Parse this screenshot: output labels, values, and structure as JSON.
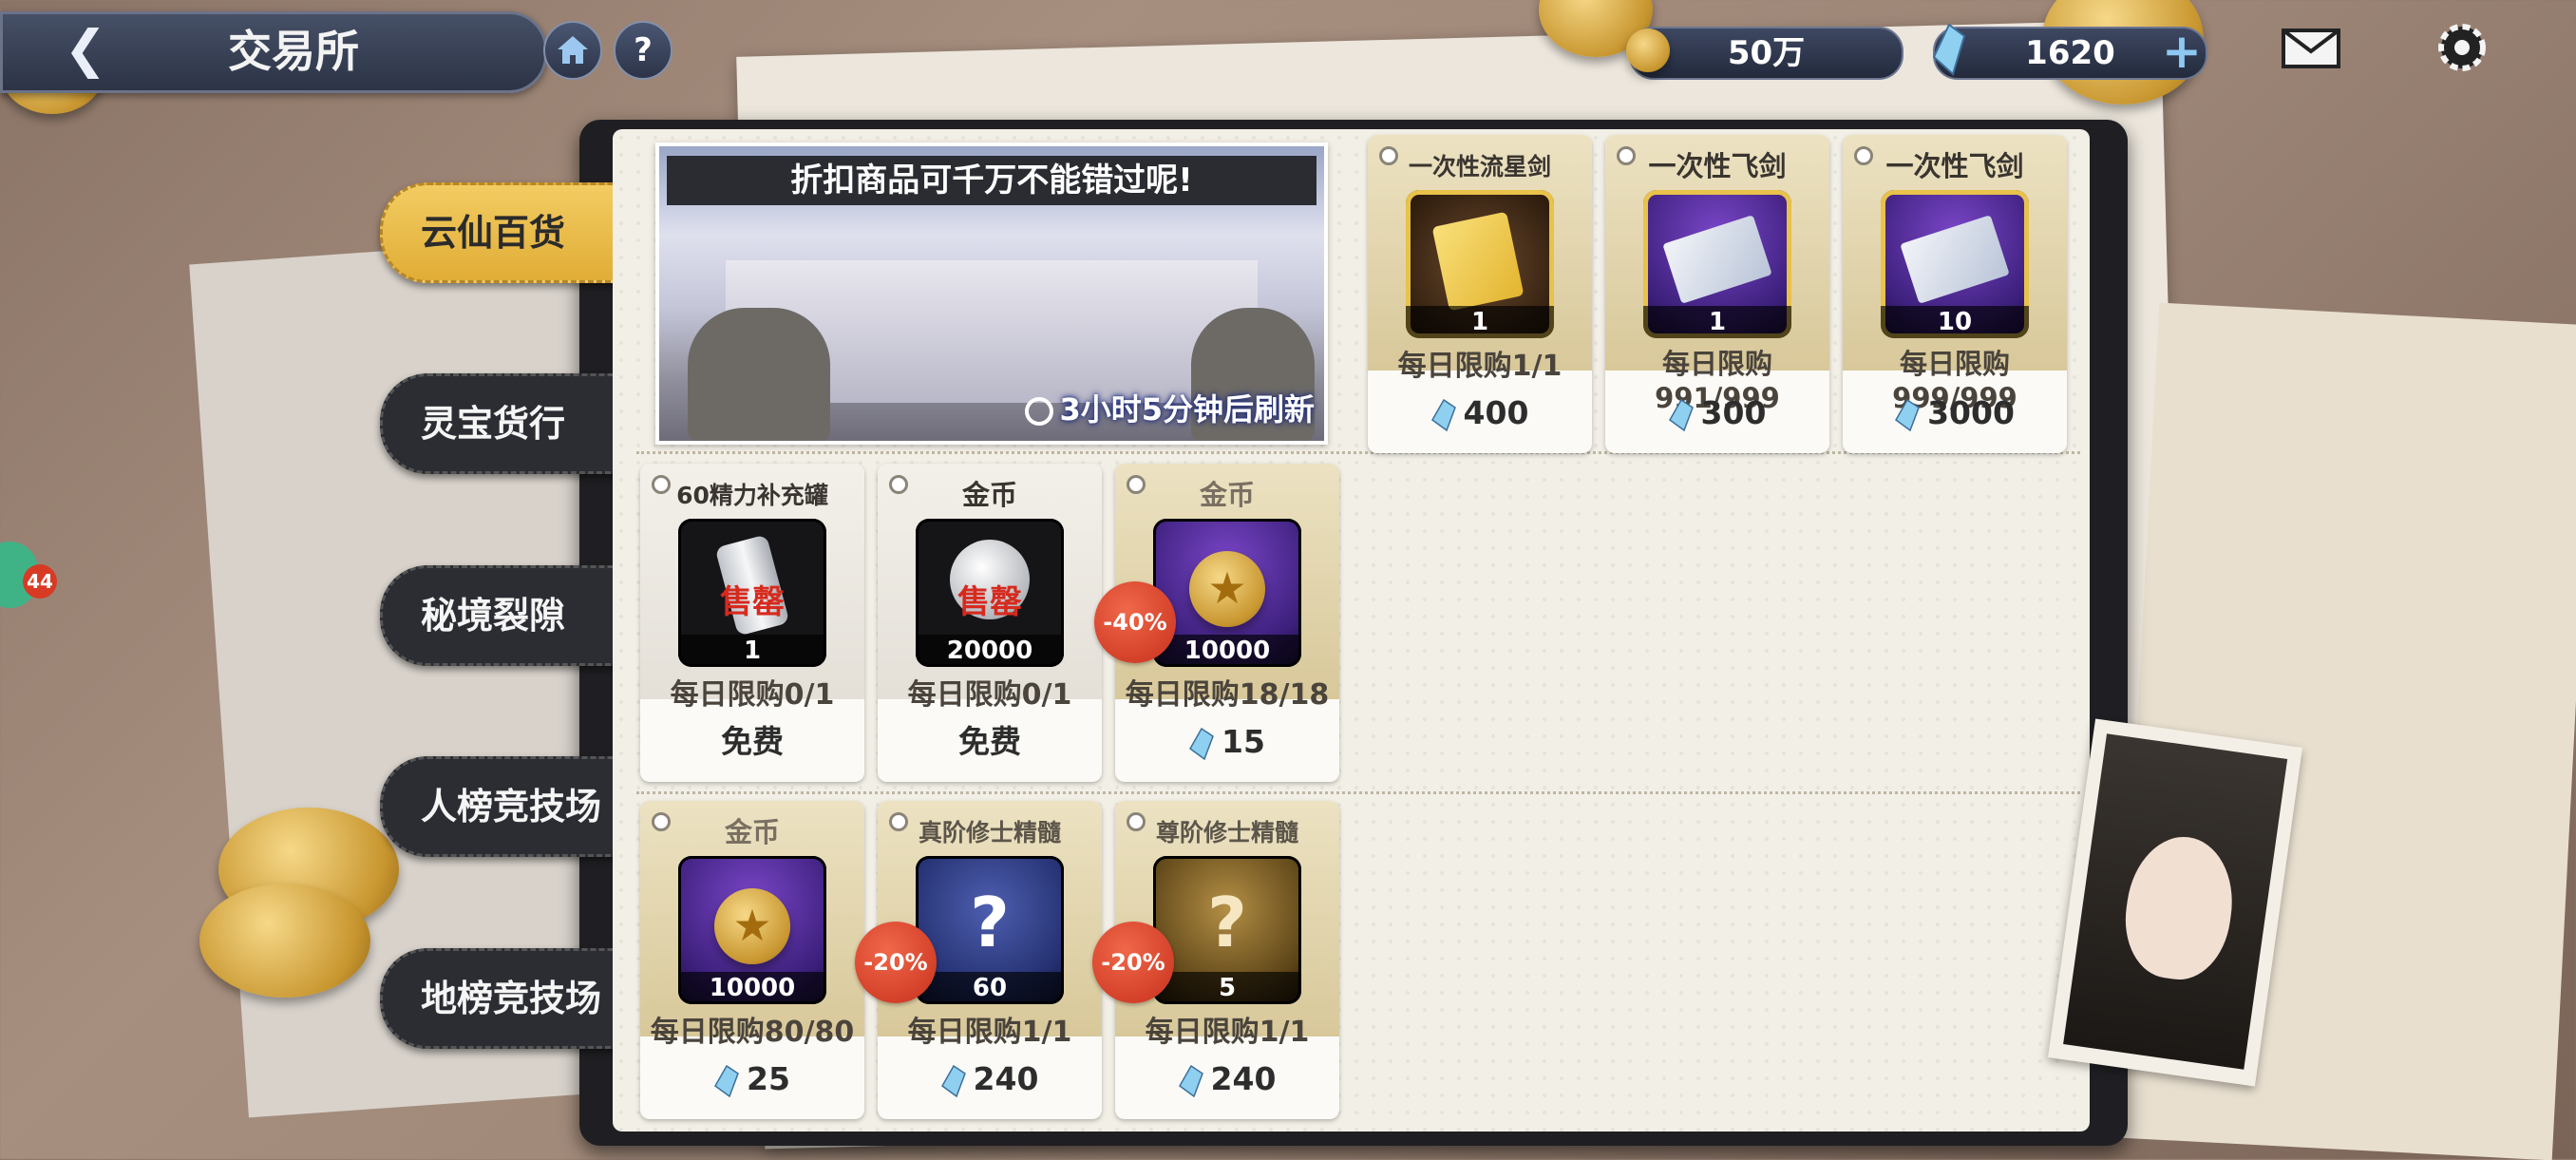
{
  "header": {
    "title": "交易所",
    "help_label": "?"
  },
  "currency": {
    "gold": "50万",
    "gems": "1620",
    "add_label": "+"
  },
  "tabs": [
    {
      "label": "云仙百货",
      "active": true
    },
    {
      "label": "灵宝货行",
      "active": false
    },
    {
      "label": "秘境裂隙",
      "active": false
    },
    {
      "label": "人榜竞技场",
      "active": false
    },
    {
      "label": "地榜竞技场",
      "active": false
    }
  ],
  "side": {
    "chat_badge": "44"
  },
  "banner": {
    "headline": "折扣商品可千万不能错过呢!",
    "timer": "3小时5分钟后刷新"
  },
  "items": [
    {
      "name": "一次性流星剑",
      "qty": "1",
      "limit": "每日限购1/1",
      "price": "400",
      "style": "gold",
      "icon": "yellow-scroll-sword-icon"
    },
    {
      "name": "一次性飞剑",
      "qty": "1",
      "limit": "每日限购991/999",
      "price": "300",
      "style": "gold",
      "icon": "paper-flying-sword-icon"
    },
    {
      "name": "一次性飞剑",
      "qty": "10",
      "limit": "每日限购999/999",
      "price": "3000",
      "style": "gold",
      "icon": "paper-flying-sword-icon"
    },
    {
      "name": "60精力补充罐",
      "qty": "1",
      "limit": "每日限购0/1",
      "price": "免费",
      "style": "white",
      "soldout": "售罄",
      "icon": "energy-can-icon"
    },
    {
      "name": "金币",
      "qty": "20000",
      "limit": "每日限购0/1",
      "price": "免费",
      "style": "white",
      "soldout": "售罄",
      "icon": "silver-coin-icon"
    },
    {
      "name": "金币",
      "qty": "10000",
      "limit": "每日限购18/18",
      "price": "15",
      "style": "gold",
      "discount": "-40%",
      "icon": "gold-coin-icon"
    },
    {
      "name": "金币",
      "qty": "10000",
      "limit": "每日限购80/80",
      "price": "25",
      "style": "gold",
      "icon": "gold-coin-icon"
    },
    {
      "name": "真阶修士精髓",
      "qty": "60",
      "limit": "每日限购1/1",
      "price": "240",
      "style": "gold",
      "discount": "-20%",
      "icon": "mystery-puzzle-icon"
    },
    {
      "name": "尊阶修士精髓",
      "qty": "5",
      "limit": "每日限购1/1",
      "price": "240",
      "style": "gold",
      "discount": "-20%",
      "icon": "mystery-puzzle-gold-icon"
    }
  ],
  "colors": {
    "tab_active": "#e8b94a",
    "tab_inactive": "#2b2d33",
    "discount": "#d83a24",
    "soldout_text": "#d62a1e",
    "gem": "#7cc4ea"
  }
}
